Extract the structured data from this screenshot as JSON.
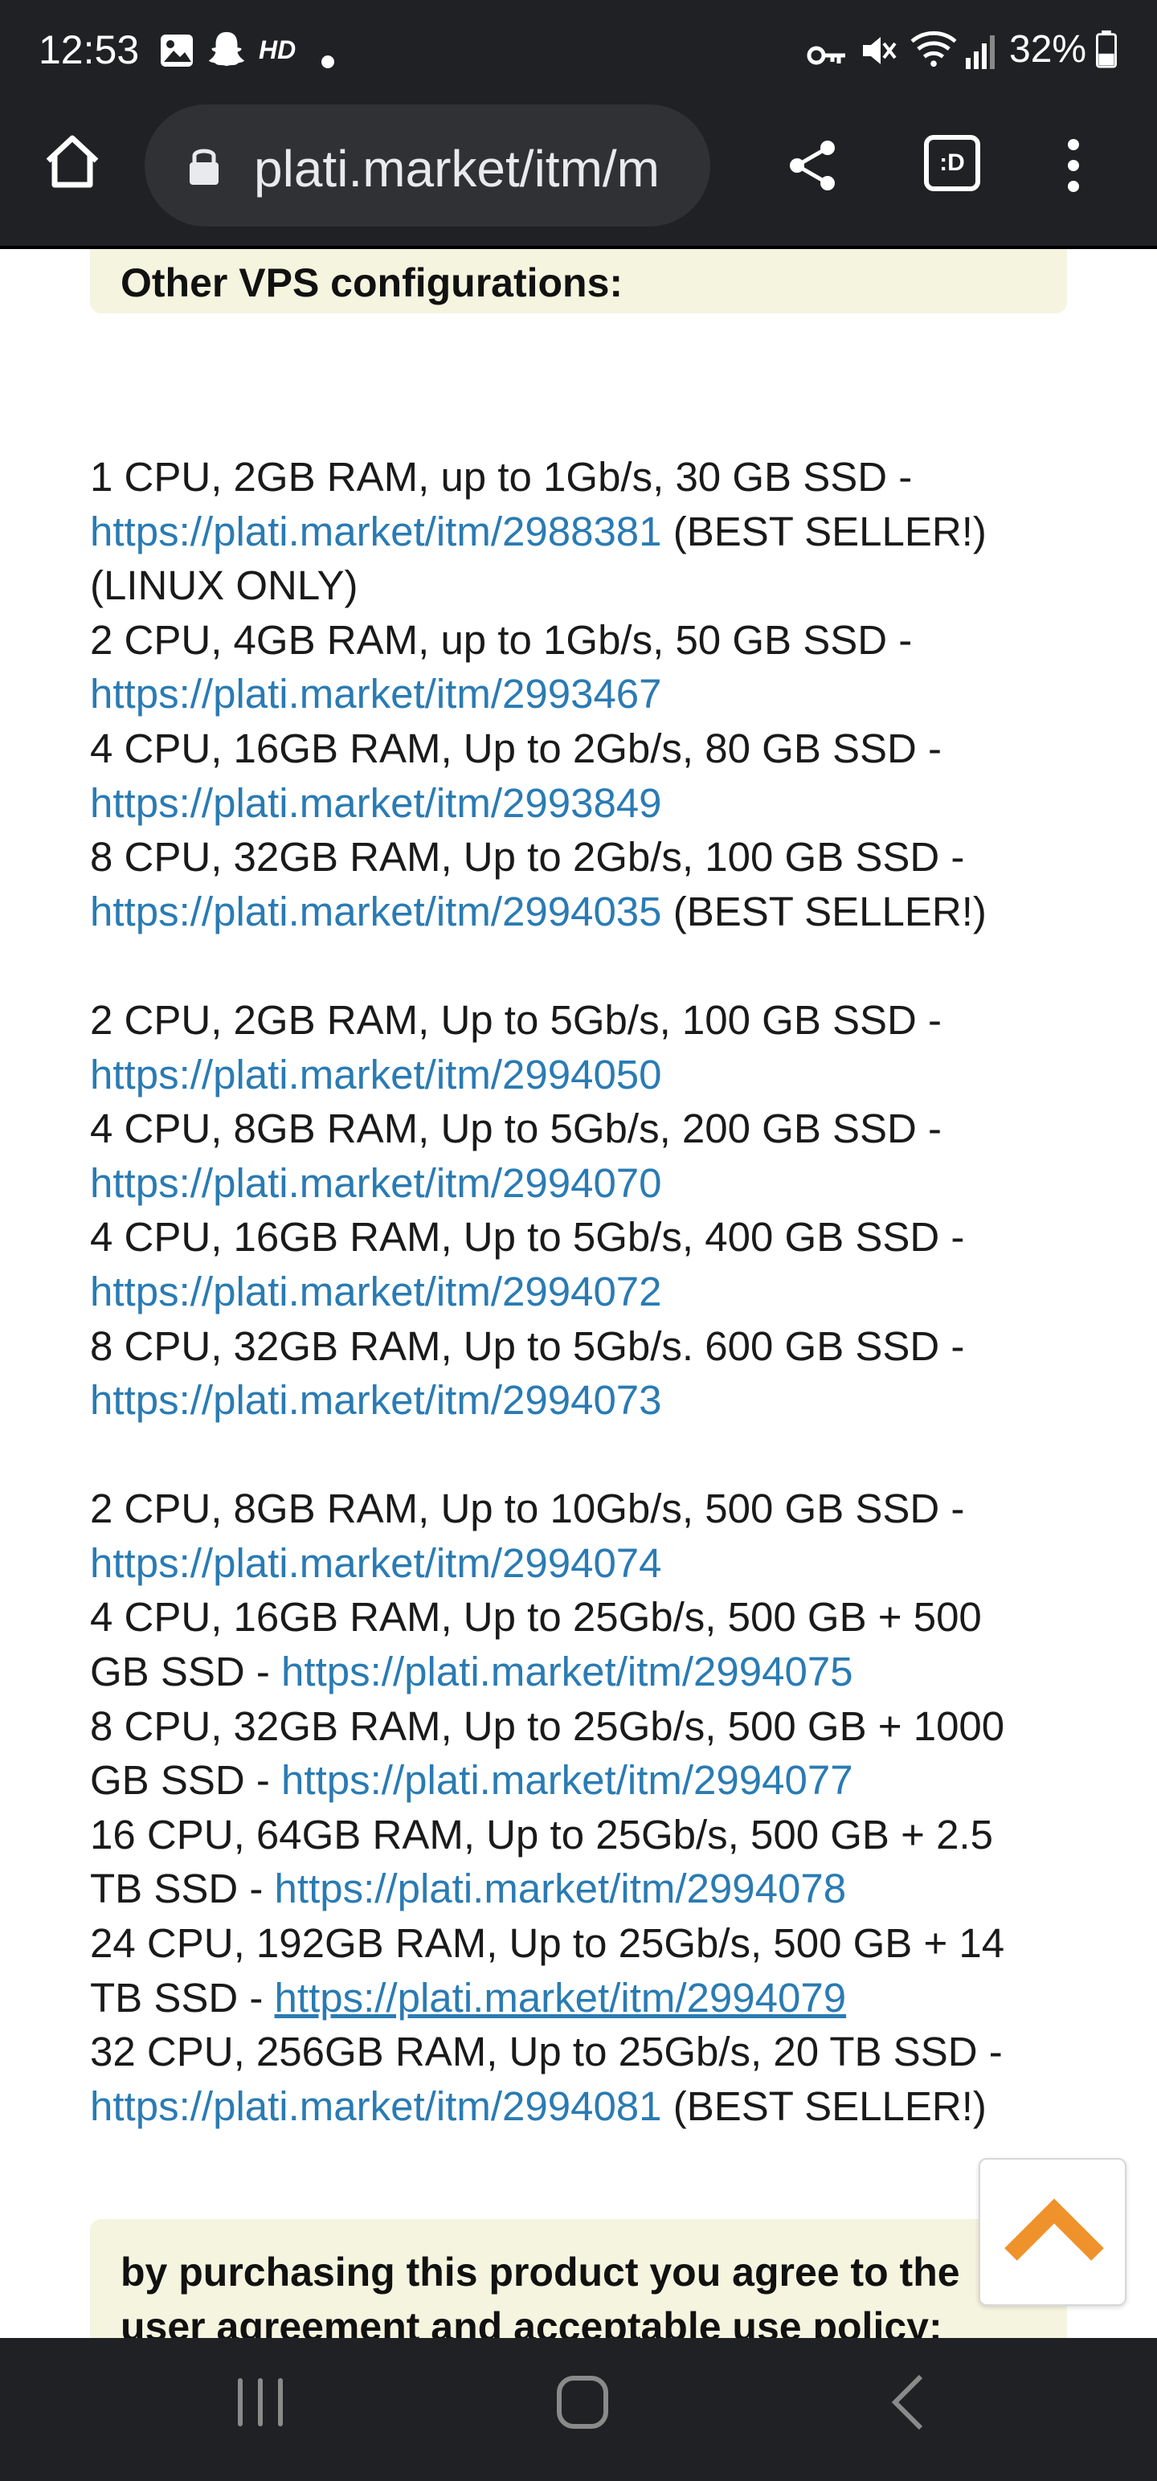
{
  "status_bar": {
    "time": "12:53",
    "battery_percent": "32%",
    "icons": [
      "gallery-icon",
      "snapchat-icon",
      "hd-icon",
      "dot-icon",
      "vpn-key-icon",
      "mute-icon",
      "wifi-icon",
      "signal-icon",
      "battery-icon"
    ],
    "hd_label": "HD"
  },
  "browser": {
    "url": "plati.market/itm/m",
    "tab_switcher_label": ":D",
    "icons": [
      "home-icon",
      "lock-icon",
      "share-icon",
      "tab-switcher-icon",
      "overflow-menu-icon"
    ]
  },
  "page": {
    "top_notice_title": "Other VPS configurations:",
    "groups": [
      [
        {
          "spec": "1 CPU, 2GB RAM, up to 1Gb/s, 30 GB SSD -",
          "link": "https://plati.market/itm/2988381",
          "suffix": "(BEST SELLER!)",
          "extra_line": "(LINUX ONLY)"
        },
        {
          "spec": "2 CPU, 4GB RAM, up to 1Gb/s, 50 GB SSD -",
          "link": "https://plati.market/itm/2993467"
        },
        {
          "spec": "4 CPU, 16GB RAM, Up to 2Gb/s, 80 GB SSD -",
          "link": "https://plati.market/itm/2993849"
        },
        {
          "spec": "8 CPU, 32GB RAM, Up to 2Gb/s, 100 GB SSD -",
          "link": "https://plati.market/itm/2994035",
          "suffix": "(BEST SELLER!)"
        }
      ],
      [
        {
          "spec": "2 CPU, 2GB RAM, Up to 5Gb/s, 100 GB SSD -",
          "link": "https://plati.market/itm/2994050"
        },
        {
          "spec": "4 CPU, 8GB RAM, Up to 5Gb/s, 200 GB SSD -",
          "link": "https://plati.market/itm/2994070"
        },
        {
          "spec": "4 CPU, 16GB RAM, Up to 5Gb/s, 400 GB SSD -",
          "link": "https://plati.market/itm/2994072"
        },
        {
          "spec": "8 CPU, 32GB RAM, Up to 5Gb/s. 600 GB SSD -",
          "link": "https://plati.market/itm/2994073"
        }
      ],
      [
        {
          "spec": "2 CPU, 8GB RAM, Up to 10Gb/s, 500 GB SSD -",
          "link": "https://plati.market/itm/2994074"
        },
        {
          "spec": "4 CPU, 16GB RAM, Up to 25Gb/s, 500 GB + 500",
          "spec_cont": "GB SSD -",
          "link": "https://plati.market/itm/2994075"
        },
        {
          "spec": "8 CPU, 32GB RAM, Up to 25Gb/s, 500 GB + 1000",
          "spec_cont": "GB SSD -",
          "link": "https://plati.market/itm/2994077"
        },
        {
          "spec": "16 CPU, 64GB RAM, Up to 25Gb/s, 500 GB + 2.5",
          "spec_cont": "TB SSD -",
          "link": "https://plati.market/itm/2994078"
        },
        {
          "spec": "24 CPU, 192GB RAM, Up to 25Gb/s, 500 GB + 14",
          "spec_cont": "TB SSD -",
          "link": "https://plati.market/itm/2994079",
          "underlined": true
        },
        {
          "spec": "32 CPU, 256GB RAM, Up to 25Gb/s, 20 TB SSD -",
          "link": "https://plati.market/itm/2994081",
          "suffix": "(BEST SELLER!)"
        }
      ]
    ],
    "bottom_notice_line1": "by purchasing this product you agree to the",
    "bottom_notice_line2": "user agreement and acceptable use policy:",
    "scroll_top_icon": "chevron-up-icon",
    "scroll_top_color": "#f0922b"
  },
  "nav_bar": {
    "icons": [
      "recent-apps-icon",
      "home-button-icon",
      "back-icon"
    ]
  },
  "colors": {
    "chrome_bg": "#202124",
    "url_pill": "#303134",
    "link": "#2a7bb3",
    "notice_bg": "#f5f4df"
  }
}
